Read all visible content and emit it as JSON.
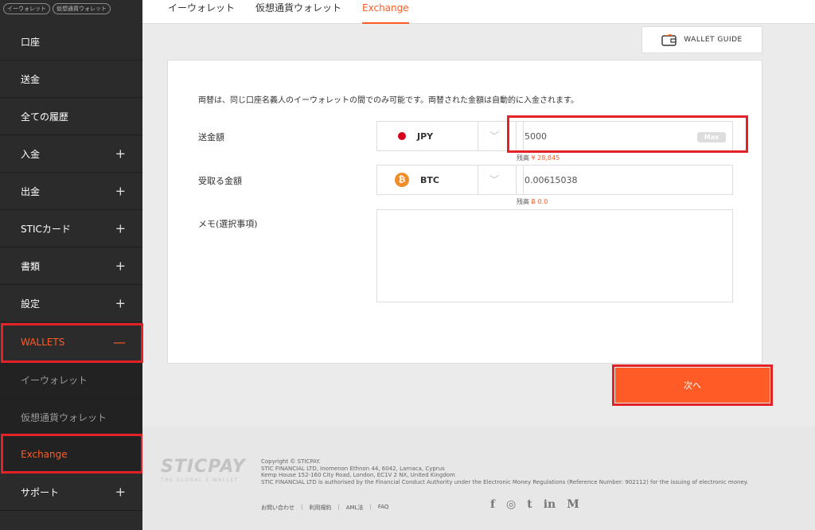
{
  "sidebar": {
    "pills": [
      "イーウォレット",
      "仮想通貨ウォレット"
    ],
    "items": [
      {
        "label": "口座"
      },
      {
        "label": "送金"
      },
      {
        "label": "全ての履歴"
      },
      {
        "label": "入金",
        "expand": "+"
      },
      {
        "label": "出金",
        "expand": "+"
      },
      {
        "label": "STICカード",
        "expand": "+"
      },
      {
        "label": "書類",
        "expand": "+"
      },
      {
        "label": "設定",
        "expand": "+"
      },
      {
        "label": "WALLETS",
        "expand": "—"
      },
      {
        "label": "イーウォレット"
      },
      {
        "label": "仮想通貨ウォレット"
      },
      {
        "label": "Exchange"
      },
      {
        "label": "サポート",
        "expand": "+"
      }
    ]
  },
  "tabs": [
    "イーウォレット",
    "仮想通貨ウォレット",
    "Exchange"
  ],
  "guide_label": "WALLET GUIDE",
  "form": {
    "notice": "両替は、同じ口座名義人のイーウォレットの間でのみ可能です。両替された金額は自動的に入金されます。",
    "send_label": "送金額",
    "receive_label": "受取る金額",
    "memo_label": "メモ(選択事項)",
    "send_currency": "JPY",
    "receive_currency": "BTC",
    "send_amount": "5000",
    "receive_amount": "0.00615038",
    "max_label": "Max",
    "balance_prefix": "残高",
    "send_balance": "¥ 28,845",
    "receive_balance": "Ƀ 0.0",
    "next_label": "次へ"
  },
  "footer": {
    "logo": "STICPAY",
    "tagline": "THE GLOBAL E-WALLET",
    "copyright": [
      "Copyright © STICPAY.",
      "STIC FINANCIAL LTD, Inomenon Ethnon 44, 6042, Larnaca, Cyprus",
      "Kemp House 152-160 City Road, London, EC1V 2 NX, United Kingdom",
      "STIC FINANCIAL LTD is authorised by the Financial Conduct Authority under the Electronic Money Regulations (Reference Number: 902112) for the issuing of electronic money."
    ],
    "links": [
      "お問い合わせ",
      "利用規約",
      "AML法",
      "FAQ"
    ],
    "social": [
      "f",
      "◎",
      "t",
      "in",
      "M"
    ]
  },
  "colors": {
    "accent": "#ff5b26",
    "sidebar": "#2b2b2b",
    "highlight": "#e32227"
  }
}
